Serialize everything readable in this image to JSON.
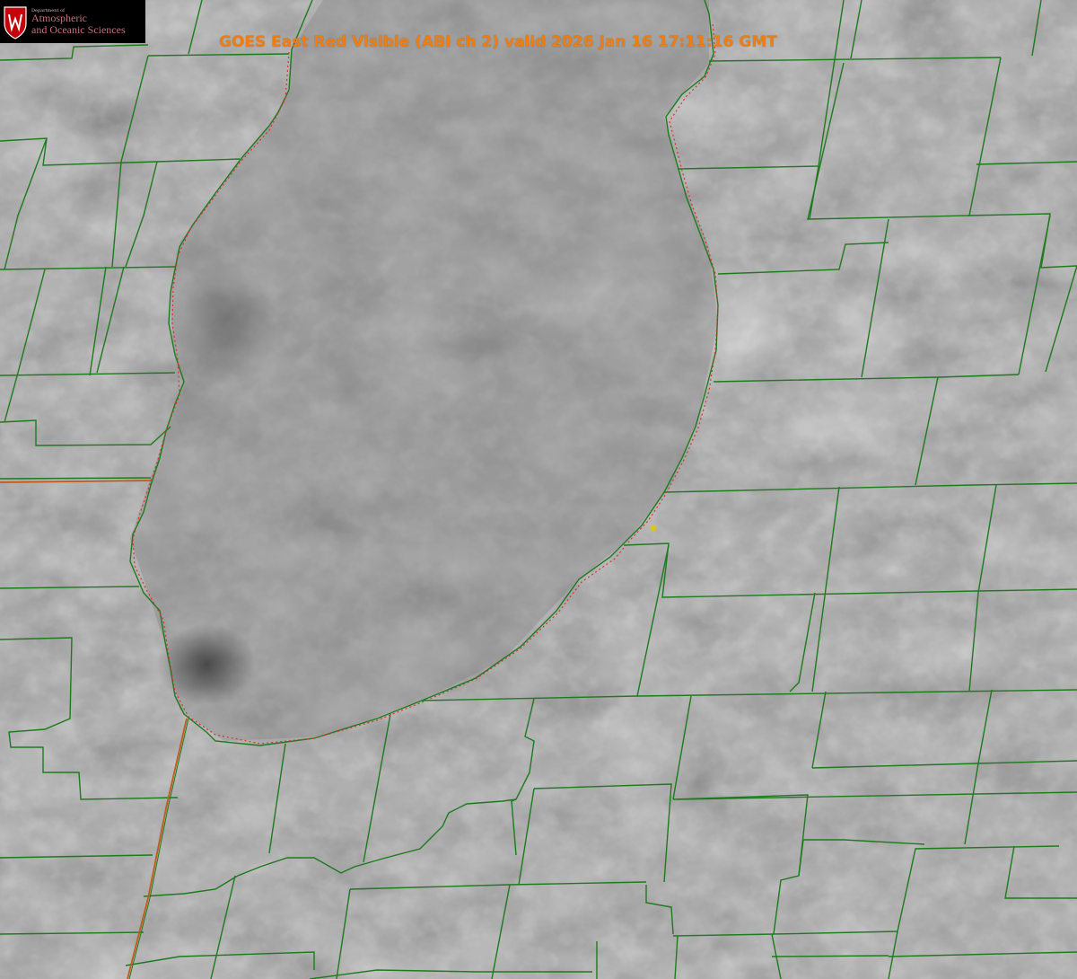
{
  "logo": {
    "department": "Department of",
    "line1": "Atmospheric",
    "line2": "and Oceanic Sciences",
    "icon": "university-crest-icon"
  },
  "title": "GOES East Red Visible (ABI ch 2) valid 2026 Jan 16 17:11:16 GMT",
  "colors": {
    "boundary": "#1e7a1e",
    "state_border": "#c15a1a",
    "lake_dotted": "#e03030",
    "marker": "#d4c820",
    "title": "#f07d10",
    "logo_text": "#c7707b"
  }
}
